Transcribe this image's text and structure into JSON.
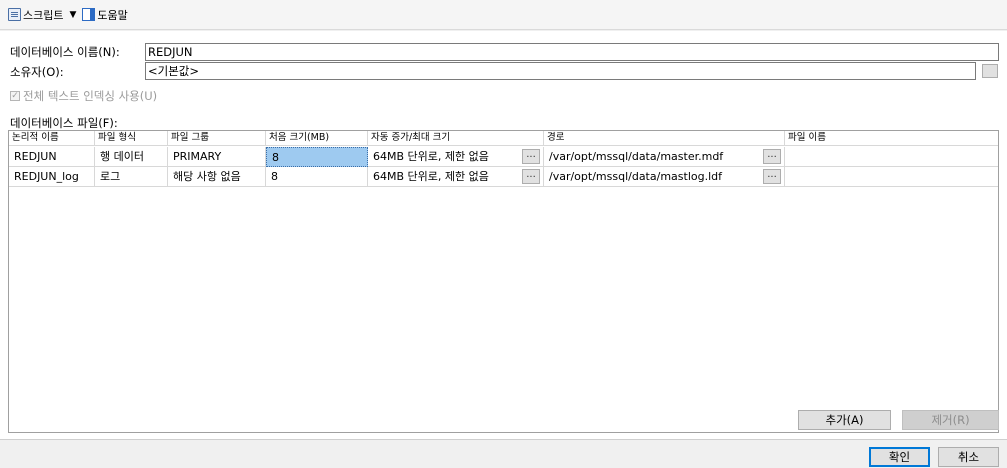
{
  "toolbar": {
    "script_label": "스크립트",
    "help_label": "도움말"
  },
  "form": {
    "db_name_label": "데이터베이스 이름(N):",
    "db_name_value": "REDJUN",
    "owner_label": "소유자(O):",
    "owner_value": "<기본값>",
    "fulltext_label": "전체 텍스트 인덱싱 사용(U)",
    "files_label": "데이터베이스 파일(F):"
  },
  "grid": {
    "columns": [
      "논리적 이름",
      "파일 형식",
      "파일 그룹",
      "처음 크기(MB)",
      "자동 증가/최대 크기",
      "경로",
      "파일 이름"
    ],
    "rows": [
      {
        "logical": "REDJUN",
        "type": "행 데이터",
        "group": "PRIMARY",
        "size": "8",
        "growth": "64MB 단위로, 제한 없음",
        "path": "/var/opt/mssql/data/master.mdf",
        "filename": ""
      },
      {
        "logical": "REDJUN_log",
        "type": "로그",
        "group": "해당 사항 없음",
        "size": "8",
        "growth": "64MB 단위로, 제한 없음",
        "path": "/var/opt/mssql/data/mastlog.ldf",
        "filename": ""
      }
    ],
    "ellipsis": "..."
  },
  "buttons": {
    "add": "추가(A)",
    "remove": "제거(R)",
    "ok": "확인",
    "cancel": "취소"
  }
}
